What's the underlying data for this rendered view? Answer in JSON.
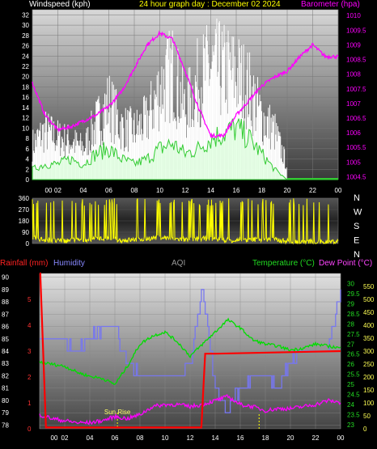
{
  "header": {
    "left_title": "Windspeed (kph)",
    "center_title": "24 hour graph day : December 02 2024",
    "right_title": "Barometer (hpa)"
  },
  "colors": {
    "wind_gust": "#ffffff",
    "wind_avg": "#33cc33",
    "barometer": "#ff00ff",
    "direction": "#ffff00",
    "rain": "#ff0000",
    "humidity": "#7777ee",
    "temperature": "#00dd00",
    "dewpoint": "#ff00ff",
    "aqi": "#aaaaaa"
  },
  "chart_data": [
    {
      "type": "line",
      "name": "wind_barometer",
      "title": "24 hour graph day : December 02 2024",
      "x_ticks": [
        "00",
        "02",
        "04",
        "06",
        "08",
        "10",
        "12",
        "14",
        "16",
        "18",
        "20",
        "22",
        "00"
      ],
      "x_range": [
        0,
        24
      ],
      "y_left_label": "Windspeed (kph)",
      "y_left_ticks": [
        "0",
        "2",
        "4",
        "6",
        "8",
        "10",
        "12",
        "14",
        "16",
        "18",
        "20",
        "22",
        "24",
        "26",
        "28",
        "30",
        "32"
      ],
      "y_left_range": [
        0,
        33
      ],
      "y_right_label": "Barometer (hpa)",
      "y_right_ticks": [
        "1004.5",
        "1005",
        "1005.5",
        "1006",
        "1006.5",
        "1007",
        "1007.5",
        "1008",
        "1008.5",
        "1009",
        "1009.5",
        "1010"
      ],
      "y_right_range": [
        1004.4,
        1010.2
      ],
      "series": [
        {
          "key": "barometer",
          "x": [
            0,
            1,
            2,
            3,
            4,
            5,
            6,
            7,
            8,
            9,
            10,
            11,
            12,
            13,
            14,
            15,
            16,
            17,
            18,
            19,
            20,
            21,
            22,
            23,
            24
          ],
          "y": [
            1007.7,
            1006.6,
            1006.1,
            1006.2,
            1006.4,
            1006.6,
            1006.9,
            1007.4,
            1008.2,
            1009.0,
            1009.4,
            1009.2,
            1008.1,
            1006.9,
            1005.9,
            1005.9,
            1006.6,
            1007.1,
            1007.6,
            1007.9,
            1008.1,
            1008.6,
            1009.0,
            1008.6,
            1008.6
          ]
        },
        {
          "key": "wind_avg",
          "x": [
            0,
            1,
            2,
            3,
            4,
            5,
            6,
            7,
            8,
            9,
            10,
            11,
            12,
            13,
            14,
            15,
            16,
            17,
            18,
            19,
            20,
            21,
            22,
            23,
            24
          ],
          "y": [
            2,
            3,
            3,
            4,
            3,
            5,
            6,
            4,
            3,
            4,
            6,
            7,
            5,
            6,
            8,
            9,
            10,
            8,
            5,
            2,
            0,
            0,
            0,
            0,
            0
          ]
        },
        {
          "key": "wind_gust",
          "x": [
            0,
            1,
            2,
            3,
            4,
            5,
            6,
            7,
            8,
            9,
            10,
            11,
            12,
            13,
            14,
            15,
            16,
            17,
            18,
            19,
            20,
            21,
            22,
            23,
            24
          ],
          "y": [
            10,
            14,
            12,
            11,
            9,
            16,
            22,
            15,
            14,
            17,
            26,
            31,
            20,
            28,
            32,
            31,
            30,
            26,
            18,
            14,
            4,
            0,
            0,
            0,
            0
          ]
        }
      ]
    },
    {
      "type": "line",
      "name": "wind_direction",
      "x_range": [
        0,
        24
      ],
      "y_ticks": [
        "0",
        "90",
        "180",
        "270",
        "360"
      ],
      "y_range": [
        0,
        360
      ],
      "compass_labels": [
        "N",
        "W",
        "S",
        "E",
        "N"
      ],
      "series": [
        {
          "key": "direction",
          "x": [
            0,
            1,
            2,
            3,
            4,
            5,
            6,
            7,
            8,
            9,
            10,
            11,
            12,
            13,
            14,
            15,
            16,
            17,
            18,
            19,
            20,
            21,
            22,
            23,
            24
          ],
          "y": [
            45,
            30,
            20,
            25,
            30,
            40,
            35,
            25,
            30,
            40,
            50,
            40,
            30,
            35,
            40,
            30,
            25,
            30,
            35,
            30,
            20,
            15,
            15,
            10,
            20
          ]
        }
      ]
    },
    {
      "type": "line",
      "name": "temperature_humidity",
      "legend_left": [
        "Rainfall (mm)",
        "Humidity"
      ],
      "legend_center": "AQI",
      "legend_right": [
        "Temperature (°C)",
        "Dew Point (°C)"
      ],
      "x_ticks": [
        "00",
        "02",
        "04",
        "06",
        "08",
        "10",
        "12",
        "14",
        "16",
        "18",
        "20",
        "22",
        "00"
      ],
      "x_range": [
        0,
        24
      ],
      "humidity_ticks": [
        "78",
        "79",
        "80",
        "81",
        "82",
        "83",
        "84",
        "85",
        "86",
        "87",
        "88",
        "89",
        "90"
      ],
      "humidity_range": [
        77.7,
        90.3
      ],
      "rain_ticks": [
        "0",
        "1",
        "2",
        "3",
        "4",
        "5"
      ],
      "rain_range": [
        0,
        6
      ],
      "temp_ticks": [
        "23",
        "23.5",
        "24",
        "24.5",
        "25",
        "25.5",
        "26",
        "26.5",
        "27",
        "27.5",
        "28",
        "28.5",
        "29",
        "29.5",
        "30"
      ],
      "temp_range": [
        22.8,
        30.5
      ],
      "aqi_ticks": [
        "0",
        "50",
        "100",
        "150",
        "200",
        "250",
        "300",
        "350",
        "400",
        "450",
        "500",
        "550"
      ],
      "annotation": "Sun Rise",
      "series": [
        {
          "key": "temperature",
          "x": [
            0,
            1,
            2,
            3,
            4,
            5,
            6,
            7,
            8,
            9,
            10,
            11,
            12,
            13,
            14,
            15,
            16,
            17,
            18,
            19,
            20,
            21,
            22,
            23,
            24
          ],
          "y": [
            26.1,
            26.0,
            25.9,
            25.6,
            25.4,
            25.3,
            25.0,
            25.9,
            27.0,
            27.4,
            27.6,
            27.1,
            26.4,
            27.0,
            27.6,
            28.2,
            27.8,
            27.2,
            27.0,
            26.9,
            26.7,
            26.8,
            27.0,
            26.9,
            26.8
          ]
        },
        {
          "key": "humidity",
          "x": [
            0,
            0.5,
            1,
            2,
            3,
            4,
            5,
            6,
            7,
            8,
            9,
            10,
            11,
            12,
            13,
            14,
            15,
            16,
            17,
            18,
            19,
            20,
            21,
            22,
            23,
            24
          ],
          "y": [
            85,
            85,
            85,
            85,
            84,
            85,
            86,
            86,
            83,
            82,
            82,
            82,
            82,
            83,
            89,
            81,
            79,
            81,
            82,
            82,
            81,
            83,
            84,
            84,
            84,
            89
          ]
        },
        {
          "key": "dewpoint",
          "x": [
            0,
            1,
            2,
            3,
            4,
            5,
            6,
            7,
            8,
            9,
            10,
            11,
            12,
            13,
            14,
            15,
            16,
            17,
            18,
            19,
            20,
            21,
            22,
            23,
            24
          ],
          "y": [
            23.5,
            23.3,
            23.2,
            23.1,
            23.1,
            23.2,
            23.4,
            23.3,
            23.5,
            23.9,
            24.0,
            24.0,
            23.9,
            24.0,
            24.2,
            24.4,
            24.0,
            23.9,
            23.7,
            23.8,
            23.8,
            23.9,
            24.0,
            24.2,
            24.1
          ]
        },
        {
          "key": "rain",
          "x": [
            0,
            0.05,
            0.5,
            12.9,
            13.2,
            14,
            24
          ],
          "y": [
            6,
            6,
            0.05,
            0.05,
            2.9,
            2.9,
            3.0
          ]
        }
      ]
    }
  ]
}
